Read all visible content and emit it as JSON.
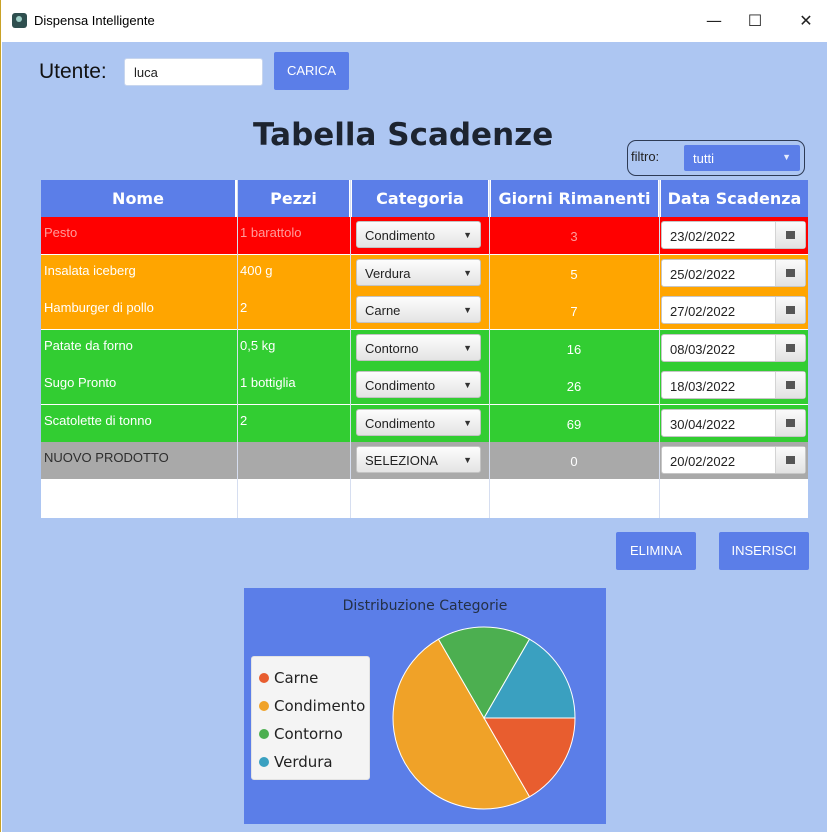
{
  "window": {
    "title": "Dispensa Intelligente",
    "minimize": "—",
    "maximize": "☐",
    "close": "✕"
  },
  "user": {
    "label": "Utente:",
    "value": "luca",
    "load_button": "CARICA"
  },
  "heading": "Tabella Scadenze",
  "filter": {
    "label": "filtro:",
    "selected": "tutti"
  },
  "table": {
    "headers": [
      "Nome",
      "Pezzi",
      "Categoria",
      "Giorni Rimanenti",
      "Data Scadenza"
    ],
    "rows": [
      {
        "name": "Pesto",
        "pezzi": "1 barattolo",
        "categoria": "Condimento",
        "giorni": "3",
        "data": "23/02/2022",
        "status": "red"
      },
      {
        "name": "Insalata iceberg",
        "pezzi": "400 g",
        "categoria": "Verdura",
        "giorni": "5",
        "data": "25/02/2022",
        "status": "orange"
      },
      {
        "name": "Hamburger di pollo",
        "pezzi": "2",
        "categoria": "Carne",
        "giorni": "7",
        "data": "27/02/2022",
        "status": "orange"
      },
      {
        "name": "Patate da forno",
        "pezzi": "0,5 kg",
        "categoria": "Contorno",
        "giorni": "16",
        "data": "08/03/2022",
        "status": "green"
      },
      {
        "name": "Sugo Pronto",
        "pezzi": "1 bottiglia",
        "categoria": "Condimento",
        "giorni": "26",
        "data": "18/03/2022",
        "status": "green"
      },
      {
        "name": "Scatolette di tonno",
        "pezzi": "2",
        "categoria": "Condimento",
        "giorni": "69",
        "data": "30/04/2022",
        "status": "green"
      },
      {
        "name": "NUOVO PRODOTTO",
        "pezzi": "",
        "categoria": "SELEZIONA",
        "giorni": "0",
        "data": "20/02/2022",
        "status": "gray"
      }
    ]
  },
  "actions": {
    "delete": "ELIMINA",
    "insert": "INSERISCI"
  },
  "colors": {
    "red": "#ff0000",
    "orange": "#ffa500",
    "green": "#32cd32",
    "gray": "#a9a9a9",
    "accent": "#5b7ee8",
    "background": "#adc6f2"
  },
  "chart_data": {
    "type": "pie",
    "title": "Distribuzione Categorie",
    "legend_position": "left",
    "categories": [
      "Carne",
      "Condimento",
      "Contorno",
      "Verdura"
    ],
    "values": [
      1,
      3,
      1,
      1
    ],
    "colors": [
      "#e85d2f",
      "#f0a228",
      "#4caf50",
      "#3aa0c0"
    ]
  }
}
